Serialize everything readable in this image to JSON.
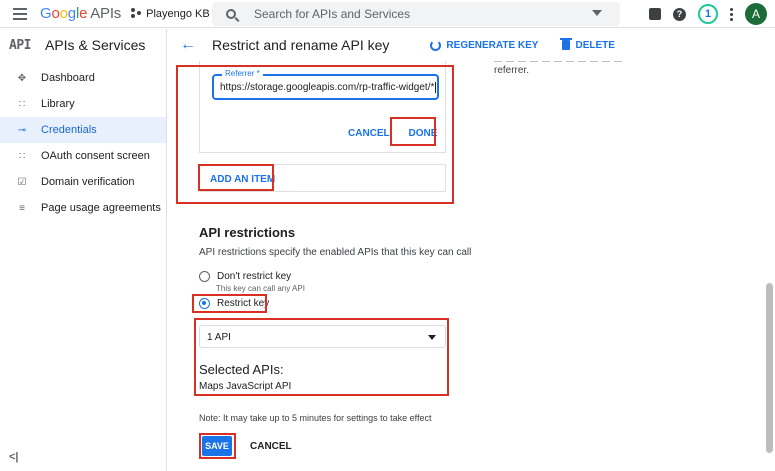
{
  "topbar": {
    "logo_google": [
      "G",
      "o",
      "o",
      "g",
      "l",
      "e"
    ],
    "logo_suffix": "APIs",
    "project_name": "Playengo KB",
    "search_placeholder": "Search for APIs and Services",
    "notification_count": "1",
    "avatar_letter": "A"
  },
  "sidebar": {
    "mark": "API",
    "title": "APIs & Services",
    "items": [
      {
        "label": "Dashboard",
        "icon": "dashboard-icon",
        "active": false
      },
      {
        "label": "Library",
        "icon": "library-icon",
        "active": false
      },
      {
        "label": "Credentials",
        "icon": "key-icon",
        "active": true
      },
      {
        "label": "OAuth consent screen",
        "icon": "consent-icon",
        "active": false
      },
      {
        "label": "Domain verification",
        "icon": "check-box-icon",
        "active": false
      },
      {
        "label": "Page usage agreements",
        "icon": "settings-list-icon",
        "active": false
      }
    ],
    "collapse_glyph": "<|"
  },
  "header": {
    "title": "Restrict and rename API key",
    "regenerate_label": "REGENERATE KEY",
    "delete_label": "DELETE"
  },
  "right_note": "referrer.",
  "referrer": {
    "label": "Referrer *",
    "value": "https://storage.googleapis.com/rp-traffic-widget/*",
    "cancel_label": "CANCEL",
    "done_label": "DONE",
    "add_item_label": "ADD AN ITEM"
  },
  "api_restrictions": {
    "title": "API restrictions",
    "description": "API restrictions specify the enabled APIs that this key can call",
    "option_none": "Don't restrict key",
    "option_none_sub": "This key can call any API",
    "option_restrict": "Restrict key",
    "selected_option": "Restrict key",
    "select_value": "1 API",
    "selected_title": "Selected APIs:",
    "selected_api": "Maps JavaScript API"
  },
  "footer": {
    "note": "Note: It may take up to 5 minutes for settings to take effect",
    "save_label": "SAVE",
    "cancel_label": "CANCEL"
  },
  "colors": {
    "accent": "#1a73e8",
    "highlight": "#d93025",
    "active_bg": "#e8f0fe"
  }
}
